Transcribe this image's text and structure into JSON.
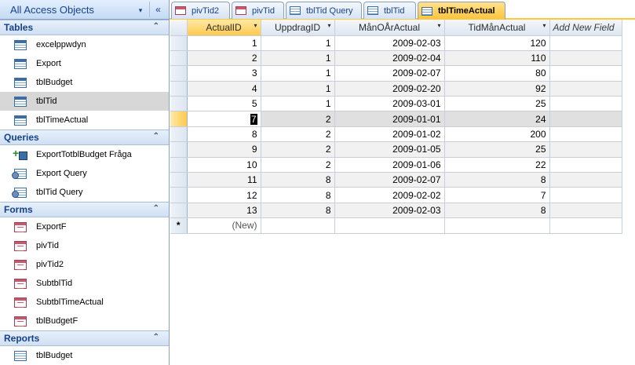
{
  "nav": {
    "title": "All Access Objects",
    "dropdown_glyph": "▾",
    "collapse_glyph": "«",
    "chevron_glyph": "⌃",
    "groups": [
      {
        "label": "Tables",
        "items": [
          {
            "label": "excelppwdyn",
            "icon": "table-icon"
          },
          {
            "label": "Export",
            "icon": "table-icon"
          },
          {
            "label": "tblBudget",
            "icon": "table-icon"
          },
          {
            "label": "tblTid",
            "icon": "table-icon",
            "selected": true
          },
          {
            "label": "tblTimeActual",
            "icon": "table-icon"
          }
        ]
      },
      {
        "label": "Queries",
        "items": [
          {
            "label": "ExportTotblBudget Fråga",
            "icon": "append-query-icon"
          },
          {
            "label": "Export Query",
            "icon": "query-icon"
          },
          {
            "label": "tblTid Query",
            "icon": "query-icon"
          }
        ]
      },
      {
        "label": "Forms",
        "items": [
          {
            "label": "ExportF",
            "icon": "form-icon"
          },
          {
            "label": "pivTid",
            "icon": "form-icon"
          },
          {
            "label": "pivTid2",
            "icon": "form-icon"
          },
          {
            "label": "SubtblTid",
            "icon": "form-icon"
          },
          {
            "label": "SubtblTimeActual",
            "icon": "form-icon"
          },
          {
            "label": "tblBudgetF",
            "icon": "form-icon"
          }
        ]
      },
      {
        "label": "Reports",
        "items": [
          {
            "label": "tblBudget",
            "icon": "report-icon"
          }
        ]
      }
    ]
  },
  "tabs": [
    {
      "label": "pivTid2",
      "icon": "form-icon"
    },
    {
      "label": "pivTid",
      "icon": "form-icon"
    },
    {
      "label": "tblTid Query",
      "icon": "query-icon"
    },
    {
      "label": "tblTid",
      "icon": "table-icon"
    },
    {
      "label": "tblTimeActual",
      "icon": "table-icon",
      "active": true
    }
  ],
  "datasheet": {
    "columns": [
      "ActualID",
      "UppdragID",
      "MånOÅrActual",
      "TidMånActual",
      "Add New Field"
    ],
    "dropdown_glyph": "▾",
    "rows": [
      [
        "1",
        "1",
        "2009-02-03",
        "120"
      ],
      [
        "2",
        "1",
        "2009-02-04",
        "110"
      ],
      [
        "3",
        "1",
        "2009-02-07",
        "80"
      ],
      [
        "4",
        "1",
        "2009-02-20",
        "92"
      ],
      [
        "5",
        "1",
        "2009-03-01",
        "25"
      ],
      [
        "7",
        "2",
        "2009-01-01",
        "24"
      ],
      [
        "8",
        "2",
        "2009-01-02",
        "200"
      ],
      [
        "9",
        "2",
        "2009-01-05",
        "25"
      ],
      [
        "10",
        "2",
        "2009-01-06",
        "22"
      ],
      [
        "11",
        "8",
        "2009-02-07",
        "8"
      ],
      [
        "12",
        "8",
        "2009-02-02",
        "7"
      ],
      [
        "13",
        "8",
        "2009-02-03",
        "8"
      ]
    ],
    "current_row": 5,
    "new_row_marker": "*",
    "new_row_placeholder": "(New)"
  }
}
